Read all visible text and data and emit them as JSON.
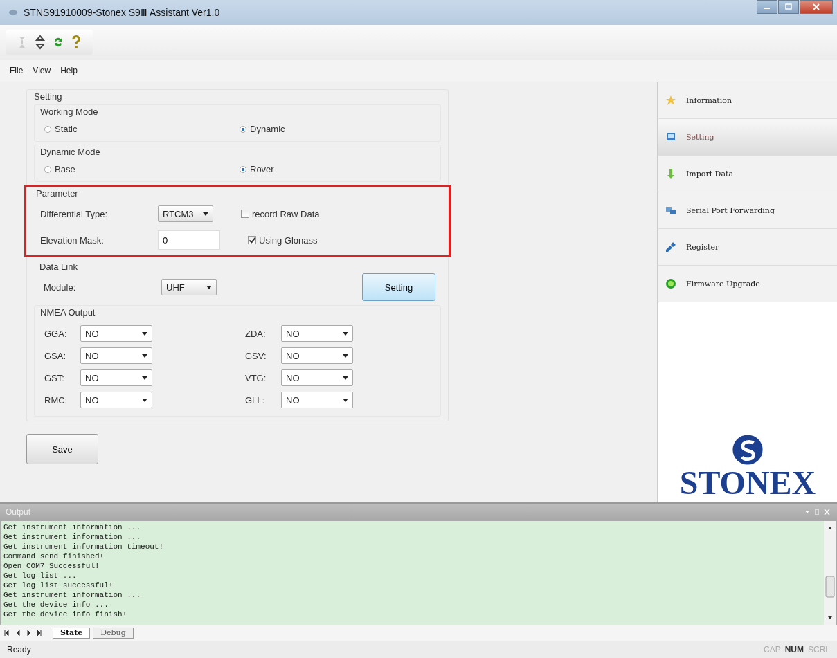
{
  "window": {
    "title": "STNS91910009-Stonex S9Ⅲ Assistant Ver1.0"
  },
  "menu": [
    "File",
    "View",
    "Help"
  ],
  "setting": {
    "title": "Setting",
    "working_mode": {
      "title": "Working Mode",
      "options": [
        {
          "label": "Static",
          "selected": false
        },
        {
          "label": "Dynamic",
          "selected": true
        }
      ]
    },
    "dynamic_mode": {
      "title": "Dynamic Mode",
      "options": [
        {
          "label": "Base",
          "selected": false
        },
        {
          "label": "Rover",
          "selected": true
        }
      ]
    },
    "parameter": {
      "title": "Parameter",
      "differential_type": {
        "label": "Differential Type:",
        "value": "RTCM3"
      },
      "elevation_mask": {
        "label": "Elevation Mask:",
        "value": "0"
      },
      "checkboxes": [
        {
          "label": "record Raw Data",
          "checked": false
        },
        {
          "label": "Using Glonass",
          "checked": true
        }
      ]
    },
    "data_link": {
      "title": "Data Link",
      "module": {
        "label": "Module:",
        "value": "UHF"
      },
      "button": "Setting"
    },
    "nmea_output": {
      "title": "NMEA Output",
      "fields": [
        {
          "label": "GGA:",
          "value": "NO"
        },
        {
          "label": "ZDA:",
          "value": "NO"
        },
        {
          "label": "GSA:",
          "value": "NO"
        },
        {
          "label": "GSV:",
          "value": "NO"
        },
        {
          "label": "GST:",
          "value": "NO"
        },
        {
          "label": "VTG:",
          "value": "NO"
        },
        {
          "label": "RMC:",
          "value": "NO"
        },
        {
          "label": "GLL:",
          "value": "NO"
        }
      ]
    },
    "save_button": "Save"
  },
  "sidebar": {
    "items": [
      {
        "label": "Information",
        "kind": "star",
        "selected": false
      },
      {
        "label": "Setting",
        "kind": "setting",
        "selected": true
      },
      {
        "label": "Import Data",
        "kind": "import",
        "selected": false
      },
      {
        "label": "Serial Port Forwarding",
        "kind": "serial",
        "selected": false
      },
      {
        "label": "Register",
        "kind": "register",
        "selected": false
      },
      {
        "label": "Firmware Upgrade",
        "kind": "firmware",
        "selected": false
      }
    ],
    "logo": "STONEX"
  },
  "output": {
    "title": "Output",
    "lines": [
      "Get instrument information ...",
      "Get instrument information ...",
      "Get instrument information timeout!",
      "Command send finished!",
      "Open COM7 Successful!",
      "Get log list ...",
      "Get log list successful!",
      "Get instrument information ...",
      "Get the device info ...",
      "Get the device info finish!"
    ],
    "tabs": [
      {
        "label": "State",
        "selected": true
      },
      {
        "label": "Debug",
        "selected": false
      }
    ]
  },
  "status_bar": {
    "text": "Ready",
    "indicators": [
      {
        "label": "CAP",
        "on": false
      },
      {
        "label": "NUM",
        "on": true
      },
      {
        "label": "SCRL",
        "on": false
      }
    ]
  }
}
